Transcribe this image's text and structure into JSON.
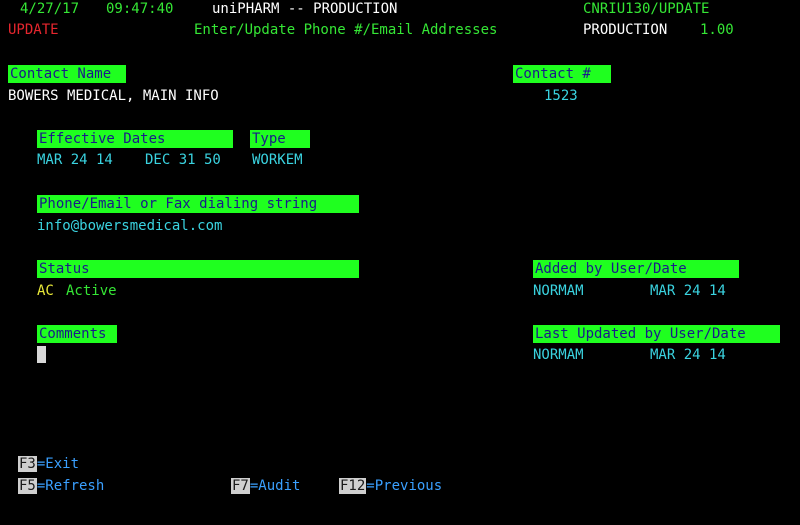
{
  "top": {
    "date": "4/27/17",
    "time": "09:47:40",
    "system": "uniPHARM -- PRODUCTION",
    "program": "CNRIU130/UPDATE",
    "mode": "UPDATE",
    "screen_title": "Enter/Update Phone #/Email Addresses",
    "environment": "PRODUCTION",
    "version": "1.00"
  },
  "contact": {
    "name_label": "Contact Name",
    "name_value": "BOWERS MEDICAL, MAIN INFO",
    "number_label": "Contact #",
    "number_value": "1523"
  },
  "dates": {
    "label": "Effective Dates",
    "from": "MAR 24 14",
    "to": "DEC 31 50",
    "type_label": "Type",
    "type_value": "WORKEM"
  },
  "dial": {
    "label": "Phone/Email or Fax dialing string",
    "value": "info@bowersmedical.com"
  },
  "status": {
    "label": "Status",
    "code": "AC",
    "text": "Active"
  },
  "added": {
    "label": "Added by User/Date",
    "user": "NORMAM",
    "date": "MAR 24 14"
  },
  "comments": {
    "label": "Comments",
    "value": ""
  },
  "updated": {
    "label": "Last Updated by User/Date",
    "user": "NORMAM",
    "date": "MAR 24 14"
  },
  "keys": {
    "f3": "F3",
    "f3_label": "=Exit",
    "f5": "F5",
    "f5_label": "=Refresh",
    "f7": "F7",
    "f7_label": "=Audit",
    "f12": "F12",
    "f12_label": "=Previous"
  }
}
